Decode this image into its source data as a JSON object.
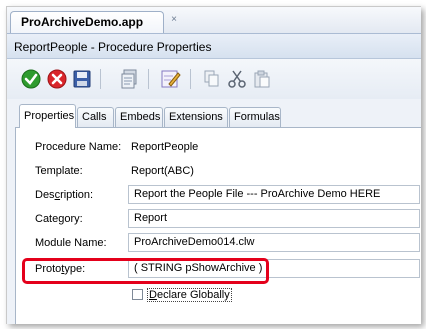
{
  "window": {
    "doc_tab": "ProArchiveDemo.app",
    "doc_tab_close": "×",
    "title": "ReportPeople - Procedure Properties"
  },
  "toolbar": {
    "buttons": [
      {
        "icon": "ok-check-icon",
        "color": "#2e9b2e"
      },
      {
        "icon": "cancel-x-icon",
        "color": "#d9262b"
      },
      {
        "icon": "save-disk-icon",
        "color": "#3b5fa8"
      },
      {
        "icon": "copy-procedure-icon",
        "color": "#8a9ab0"
      },
      {
        "icon": "edit-pencil-icon",
        "color": "#6b5ab7"
      },
      {
        "icon": "copy-icon",
        "color": "#9aa6b6"
      },
      {
        "icon": "cut-scissors-icon",
        "color": "#5a6472"
      },
      {
        "icon": "paste-icon",
        "color": "#9aa6b6"
      }
    ]
  },
  "tabs": [
    "Properties",
    "Calls",
    "Embeds",
    "Extensions",
    "Formulas"
  ],
  "active_tab": "Properties",
  "form": {
    "procedure_name_label": "Procedure Name:",
    "procedure_name_value": "ReportPeople",
    "template_label": "Template:",
    "template_value": "Report(ABC)",
    "description_label_pre": "Des",
    "description_label_u": "c",
    "description_label_post": "ription:",
    "description_value": "Report the People File   ---   ProArchive Demo HERE",
    "category_label": "Category:",
    "category_value": "Report",
    "module_label": "Module Name:",
    "module_value": "ProArchiveDemo014.clw",
    "prototype_label_pre": "Proto",
    "prototype_label_u": "t",
    "prototype_label_post": "ype:",
    "prototype_value": "( STRING pShowArchive )",
    "declare_globally_pre": "",
    "declare_globally_u": "D",
    "declare_globally_post": "eclare Globally",
    "declare_globally_checked": false
  },
  "colors": {
    "highlight": "#e4001b",
    "panel_border": "#a8b6c8"
  }
}
